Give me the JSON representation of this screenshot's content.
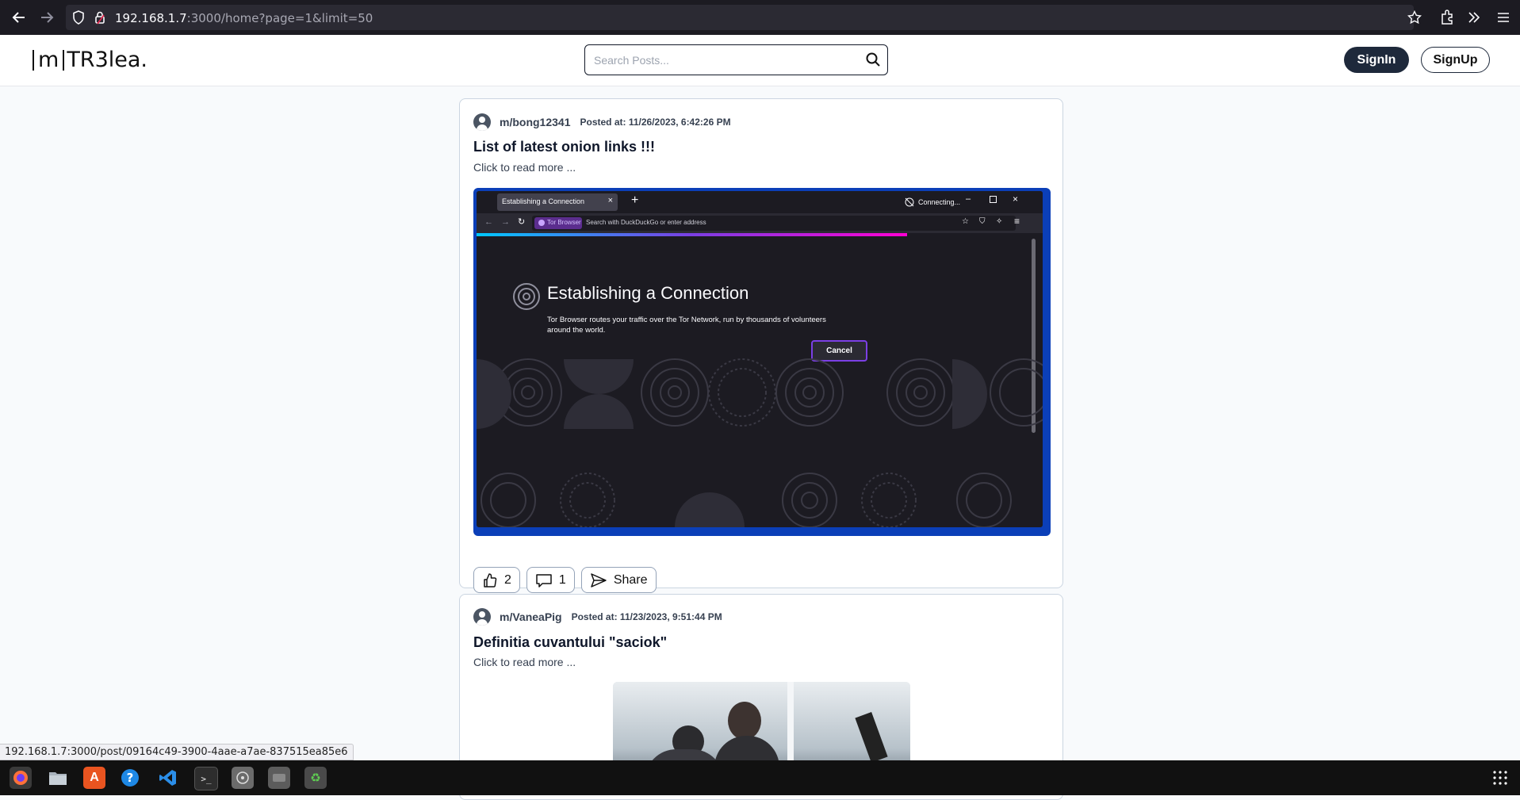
{
  "browser": {
    "url_host": "192.168.1.7",
    "url_rest": ":3000/home?page=1&limit=50"
  },
  "header": {
    "logo_bracket": "m",
    "logo_text": "TR3lea.",
    "search_placeholder": "Search Posts...",
    "signin_label": "SignIn",
    "signup_label": "SignUp"
  },
  "posts": [
    {
      "author": "m/bong12341",
      "posted": "Posted at: 11/26/2023, 6:42:26 PM",
      "title": "List of latest onion links !!!",
      "read_more": "Click to read more ...",
      "likes": "2",
      "comments": "1",
      "share_label": "Share",
      "image": {
        "tab_label": "Establishing a Connection",
        "status": "Connecting...",
        "badge": "Tor Browser",
        "address_placeholder": "Search with DuckDuckGo or enter address",
        "heading": "Establishing a Connection",
        "body": "Tor Browser routes your traffic over the Tor Network, run by thousands of volunteers around the world.",
        "cancel_label": "Cancel"
      }
    },
    {
      "author": "m/VaneaPig",
      "posted": "Posted at: 11/23/2023, 9:51:44 PM",
      "title": "Definitia cuvantului \"saciok\"",
      "read_more": "Click to read more ..."
    }
  ],
  "status_url": "192.168.1.7:3000/post/09164c49-3900-4aae-a7ae-837515ea85e6",
  "taskbar": [
    "firefox-icon",
    "files-icon",
    "app-center-icon",
    "help-icon",
    "vscode-icon",
    "terminal-icon",
    "disk-icon",
    "drive-icon",
    "trash-icon",
    "app-grid-icon"
  ],
  "colors": {
    "accent": "#1e293b",
    "image_border": "#0b3fb8",
    "tor_purple": "#7b3fe4"
  }
}
